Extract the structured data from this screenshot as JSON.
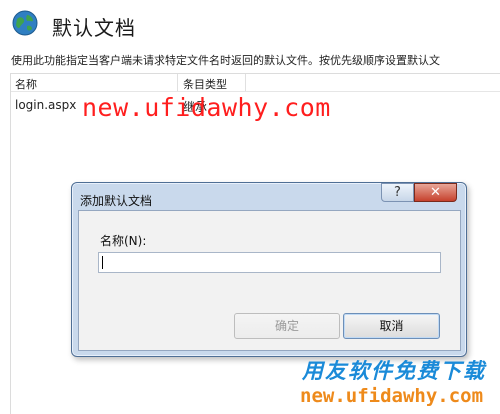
{
  "header": {
    "title": "默认文档",
    "icon": "globe-icon"
  },
  "description": "使用此功能指定当客户端未请求特定文件名时返回的默认文件。按优先级顺序设置默认文",
  "list": {
    "columns": [
      "名称",
      "条目类型"
    ],
    "rows": [
      {
        "name": "login.aspx",
        "type": "继承"
      }
    ]
  },
  "watermark": {
    "top_url": "new.ufidawhy.com",
    "bottom_cn": "用友软件免费下载",
    "bottom_url": "new.ufidawhy.com"
  },
  "dialog": {
    "title": "添加默认文档",
    "help_label": "?",
    "close_label": "✕",
    "field_label": "名称(N):",
    "field_value": "",
    "ok_label": "确定",
    "cancel_label": "取消"
  },
  "colors": {
    "watermark_red": "#ff1e1e",
    "watermark_blue": "#1a8ad8",
    "watermark_orange": "#ee8a1b",
    "close_red": "#c6412d"
  }
}
